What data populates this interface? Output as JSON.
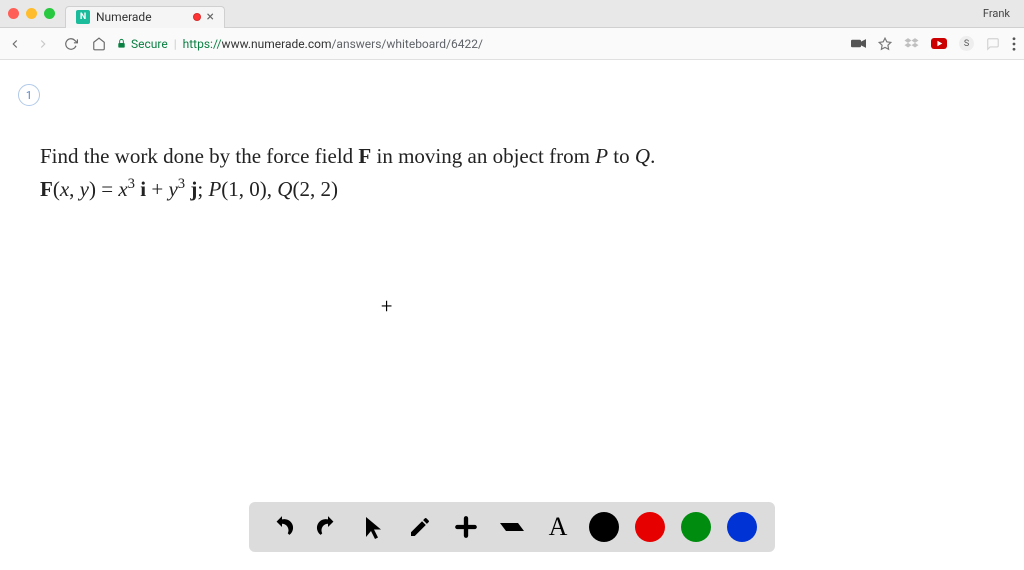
{
  "window": {
    "username": "Frank"
  },
  "tab": {
    "favicon_letter": "N",
    "title": "Numerade"
  },
  "browser": {
    "secure_label": "Secure",
    "url_scheme": "https",
    "url_domain": "www.numerade.com",
    "url_path": "/answers/whiteboard/6422/"
  },
  "page": {
    "page_number": "1",
    "problem_line1_pre": "Find the work done by the force field ",
    "problem_line1_F": "F",
    "problem_line1_mid": " in moving an object from ",
    "problem_line1_P": "P",
    "problem_line1_to": " to ",
    "problem_line1_Q": "Q",
    "problem_line1_end": ".",
    "problem_line2_html": "<span class=\"bold\">F</span>(<span class=\"italic\">x</span>, <span class=\"italic\">y</span>) = <span class=\"italic\">x</span><sup>3</sup> <span class=\"bold\">i</span> + <span class=\"italic\">y</span><sup>3</sup> <span class=\"bold\">j</span>; <span class=\"italic\">P</span>(1, 0), <span class=\"italic\">Q</span>(2, 2)"
  },
  "toolbar": {
    "text_tool_label": "A",
    "cross_cursor": "+"
  },
  "colors": {
    "black": "#000000",
    "red": "#e60000",
    "green": "#008c0f",
    "blue": "#0033d6"
  }
}
